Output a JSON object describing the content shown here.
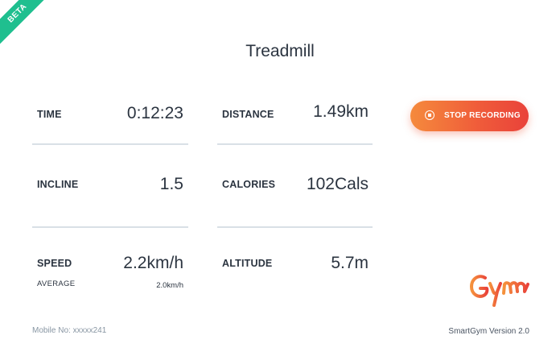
{
  "badge": {
    "label": "BETA"
  },
  "title": "Treadmill",
  "metrics": {
    "time": {
      "label": "TIME",
      "value": "0:12:23"
    },
    "distance": {
      "label": "DISTANCE",
      "value": "1.49km"
    },
    "incline": {
      "label": "INCLINE",
      "value": "1.5"
    },
    "calories": {
      "label": "CALORIES",
      "value": "102Cals"
    },
    "speed": {
      "label": "SPEED",
      "value": "2.2km/h",
      "sub_label": "AVERAGE",
      "sub_value": "2.0km/h"
    },
    "altitude": {
      "label": "ALTITUDE",
      "value": "5.7m"
    }
  },
  "record_button": {
    "label": "STOP RECORDING",
    "icon": "stop-circle-icon"
  },
  "logo": {
    "text": "Gym",
    "icon": "smartgym-logo"
  },
  "footer": {
    "mobile": "Mobile No: xxxxx241",
    "version": "SmartGym Version 2.0"
  },
  "colors": {
    "accent_start": "#f58a3c",
    "accent_end": "#e9423a",
    "beta": "#1fbf8f",
    "text": "#2b3440",
    "divider": "#d9e0e6"
  }
}
